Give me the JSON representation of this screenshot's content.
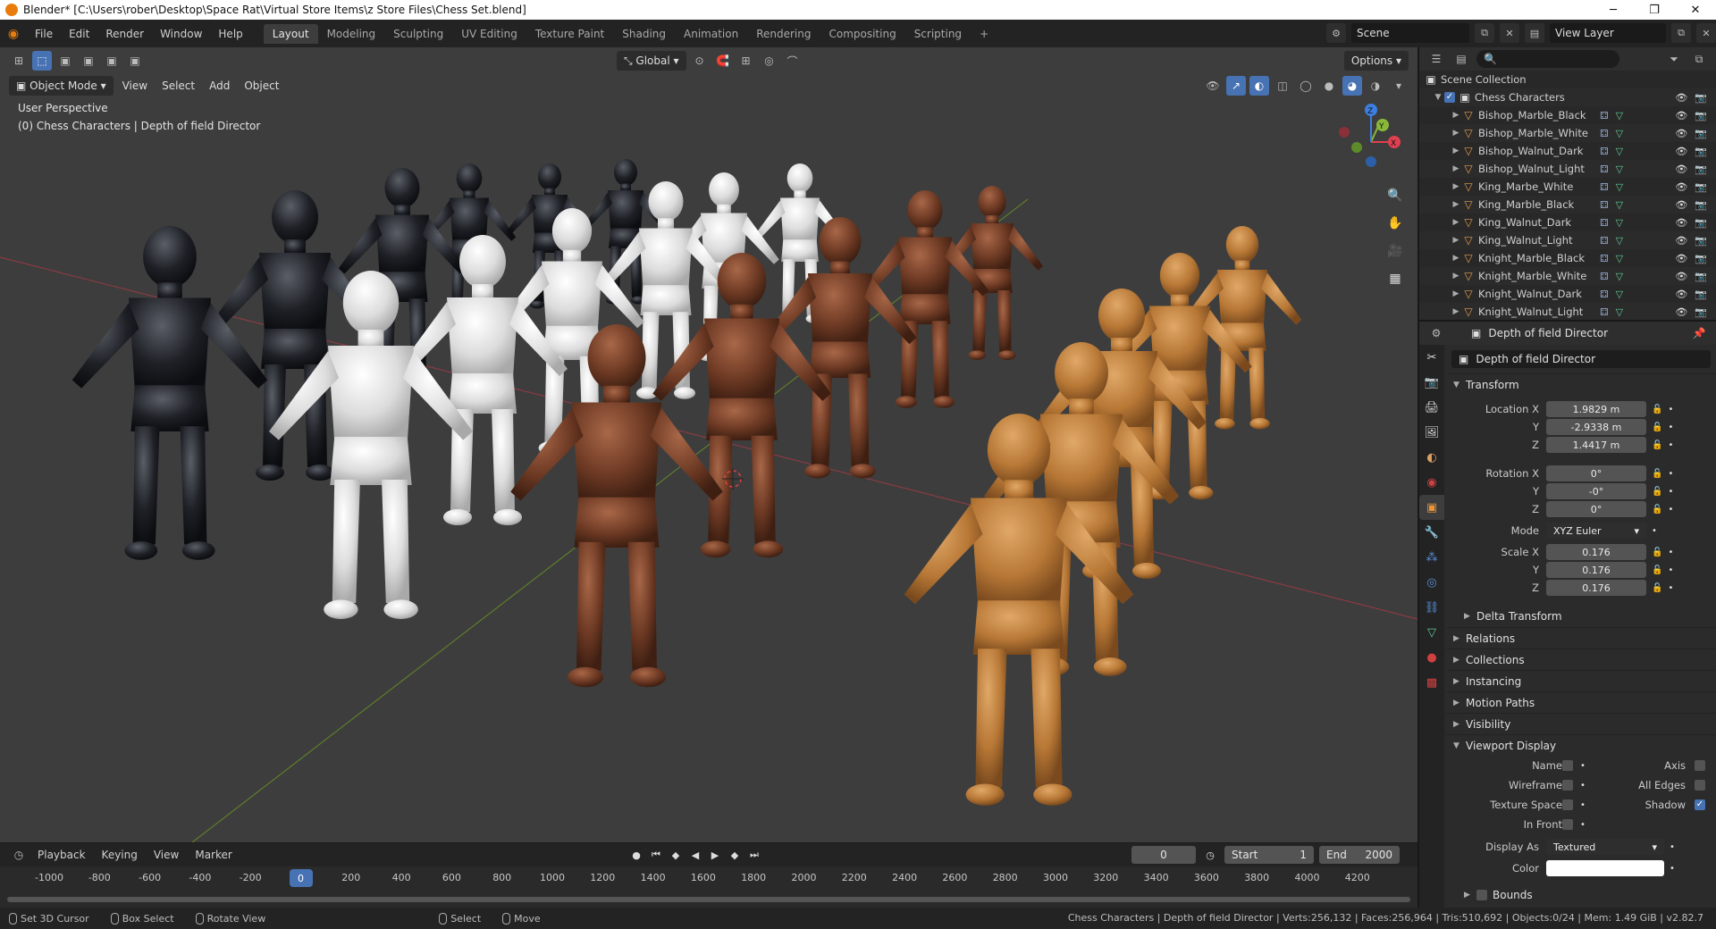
{
  "window": {
    "title": "Blender* [C:\\Users\\rober\\Desktop\\Space Rat\\Virtual Store Items\\z Store Files\\Chess Set.blend]",
    "minimize": "─",
    "maximize": "❐",
    "close": "✕"
  },
  "topbar": {
    "menus": [
      "File",
      "Edit",
      "Render",
      "Window",
      "Help"
    ],
    "workspaces": [
      "Layout",
      "Modeling",
      "Sculpting",
      "UV Editing",
      "Texture Paint",
      "Shading",
      "Animation",
      "Rendering",
      "Compositing",
      "Scripting",
      "+"
    ],
    "active_workspace": "Layout",
    "scene": "Scene",
    "view_layer": "View Layer"
  },
  "viewport": {
    "mode": "Object Mode",
    "menus": [
      "View",
      "Select",
      "Add",
      "Object"
    ],
    "transform_orientation": "Global",
    "options": "Options",
    "overlay_line1": "User Perspective",
    "overlay_line2": "(0) Chess Characters | Depth of field Director",
    "gizmo": {
      "x": "X",
      "y": "Y",
      "z": "Z"
    }
  },
  "timeline": {
    "menus": [
      "Playback",
      "Keying",
      "View",
      "Marker"
    ],
    "current_frame": "0",
    "start_label": "Start",
    "start": "1",
    "end_label": "End",
    "end": "2000",
    "ruler": [
      "-1000",
      "-800",
      "-600",
      "-400",
      "-200",
      "0",
      "200",
      "400",
      "600",
      "800",
      "1000",
      "1200",
      "1400",
      "1600",
      "1800",
      "2000",
      "2200",
      "2400",
      "2600",
      "2800",
      "3000",
      "3200",
      "3400",
      "3600",
      "3800",
      "4000",
      "4200"
    ]
  },
  "statusbar": {
    "items": [
      "Set 3D Cursor",
      "Box Select",
      "Rotate View",
      "Select",
      "Move"
    ],
    "info": "Chess Characters | Depth of field Director | Verts:256,132 | Faces:256,964 | Tris:510,692 | Objects:0/24 | Mem: 1.49 GiB | v2.82.7"
  },
  "outliner": {
    "root": "Scene Collection",
    "collection": "Chess Characters",
    "objects": [
      "Bishop_Marble_Black",
      "Bishop_Marble_White",
      "Bishop_Walnut_Dark",
      "Bishop_Walnut_Light",
      "King_Marbe_White",
      "King_Marble_Black",
      "King_Walnut_Dark",
      "King_Walnut_Light",
      "Knight_Marble_Black",
      "Knight_Marble_White",
      "Knight_Walnut_Dark",
      "Knight_Walnut_Light"
    ]
  },
  "properties": {
    "header": "Depth of field Director",
    "object_name": "Depth of field Director",
    "transform_title": "Transform",
    "location": {
      "label_x": "Location X",
      "label_y": "Y",
      "label_z": "Z",
      "x": "1.9829 m",
      "y": "-2.9338 m",
      "z": "1.4417 m"
    },
    "rotation": {
      "label_x": "Rotation X",
      "label_y": "Y",
      "label_z": "Z",
      "x": "0°",
      "y": "-0°",
      "z": "0°"
    },
    "mode_label": "Mode",
    "mode": "XYZ Euler",
    "scale": {
      "label_x": "Scale X",
      "label_y": "Y",
      "label_z": "Z",
      "x": "0.176",
      "y": "0.176",
      "z": "0.176"
    },
    "delta": "Delta Transform",
    "panels": [
      "Relations",
      "Collections",
      "Instancing",
      "Motion Paths",
      "Visibility"
    ],
    "viewport_display": "Viewport Display",
    "vd": {
      "name": "Name",
      "axis": "Axis",
      "wireframe": "Wireframe",
      "all_edges": "All Edges",
      "texture_space": "Texture Space",
      "shadow": "Shadow",
      "in_front": "In Front",
      "display_as_label": "Display As",
      "display_as": "Textured",
      "color_label": "Color",
      "bounds": "Bounds"
    }
  }
}
